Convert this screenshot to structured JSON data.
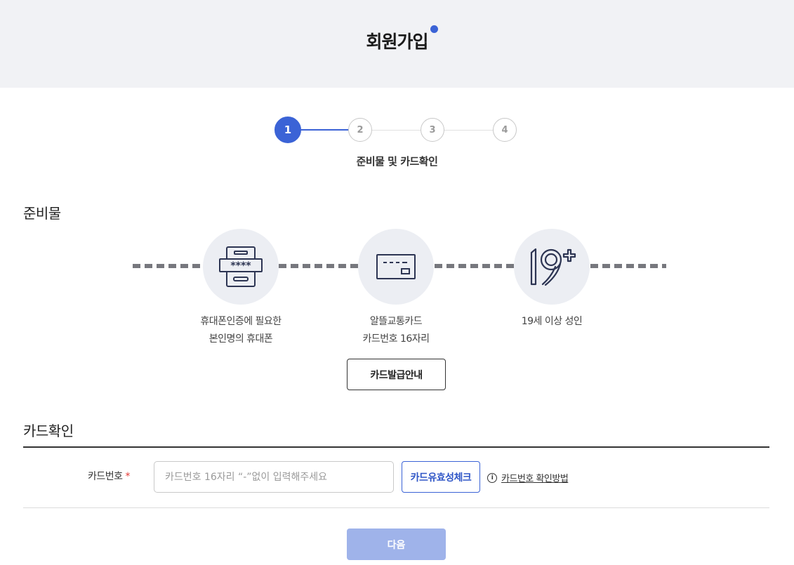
{
  "header": {
    "title": "회원가입"
  },
  "stepper": {
    "steps": [
      "1",
      "2",
      "3",
      "4"
    ],
    "current_caption": "준비물 및 카드확인"
  },
  "requirements": {
    "section_title": "준비물",
    "items": [
      {
        "icon": "phone-password-icon",
        "line1": "휴대폰인증에 필요한",
        "line2": "본인명의 휴대폰"
      },
      {
        "icon": "transit-card-icon",
        "line1": "알뜰교통카드",
        "line2": "카드번호 16자리"
      },
      {
        "icon": "age-19-plus-icon",
        "line1": "19세 이상 성인",
        "line2": ""
      }
    ],
    "issue_button": "카드발급안내"
  },
  "card_check": {
    "section_title": "카드확인",
    "field_label": "카드번호",
    "required_mark": "*",
    "input_placeholder": "카드번호 16자리 “-”없이 입력해주세요",
    "input_value": "",
    "check_button": "카드유효성체크",
    "help_link": "카드번호 확인방법",
    "help_icon": "i"
  },
  "footer": {
    "next_button": "다음"
  },
  "colors": {
    "accent": "#3b63d6",
    "next_disabled": "#9fb3ea",
    "header_bg": "#f1f2f5"
  }
}
